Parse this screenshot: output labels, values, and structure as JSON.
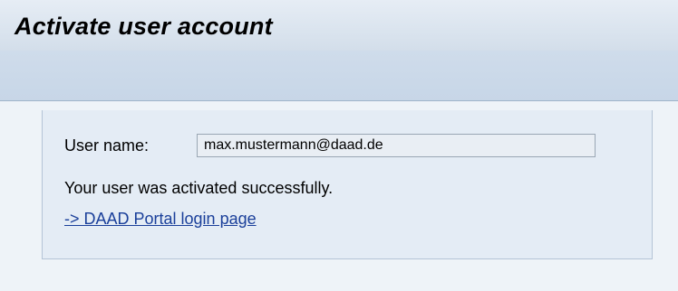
{
  "header": {
    "title": "Activate user account"
  },
  "form": {
    "username_label": "User name:",
    "username_value": "max.mustermann@daad.de"
  },
  "status": {
    "message": "Your user was activated successfully."
  },
  "links": {
    "portal_login": "-> DAAD Portal login page"
  },
  "colors": {
    "title_bar": "#dbe4ef",
    "toolbar_strip": "#cad8e8",
    "panel_background": "#e4ecf5",
    "link": "#1a3f9a"
  }
}
